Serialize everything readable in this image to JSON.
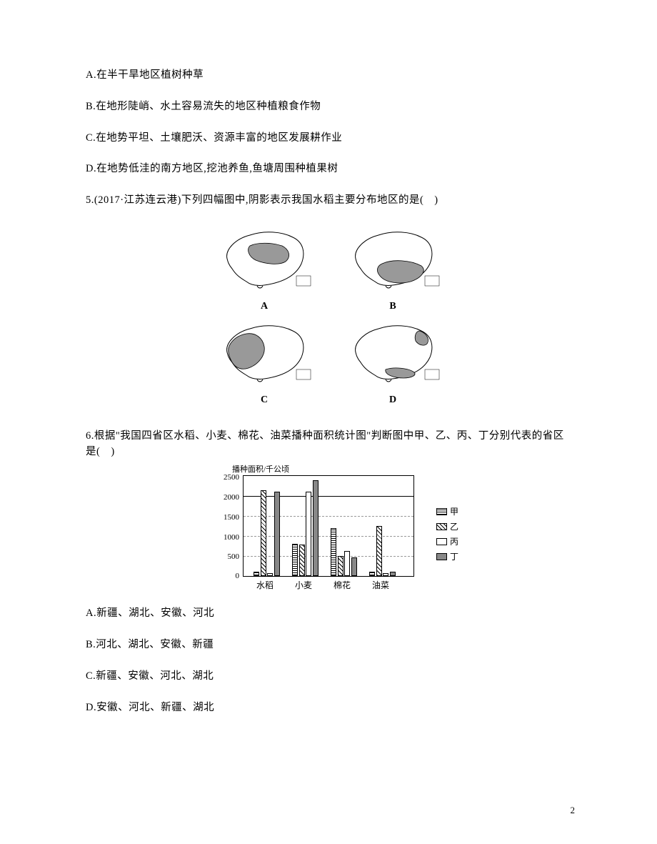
{
  "options_q4": {
    "A": "A.在半干旱地区植树种草",
    "B": "B.在地形陡峭、水土容易流失的地区种植粮食作物",
    "C": "C.在地势平坦、土壤肥沃、资源丰富的地区发展耕作业",
    "D": "D.在地势低洼的南方地区,挖池养鱼,鱼塘周围种植果树"
  },
  "q5": {
    "stem": "5.(2017·江苏连云港)下列四幅图中,阴影表示我国水稻主要分布地区的是(　)",
    "labels": {
      "A": "A",
      "B": "B",
      "C": "C",
      "D": "D"
    }
  },
  "q6": {
    "stem": "6.根据\"我国四省区水稻、小麦、棉花、油菜播种面积统计图\"判断图中甲、乙、丙、丁分别代表的省区是(　)",
    "options": {
      "A": "A.新疆、湖北、安徽、河北",
      "B": "B.河北、湖北、安徽、新疆",
      "C": "C.新疆、安徽、河北、湖北",
      "D": "D.安徽、河北、新疆、湖北"
    }
  },
  "chart_data": {
    "type": "bar",
    "title": "",
    "ylabel": "播种面积/千公顷",
    "xlabel": "",
    "ylim": [
      0,
      2500
    ],
    "yticks": [
      0,
      500,
      1000,
      1500,
      2000,
      2500
    ],
    "categories": [
      "水稻",
      "小麦",
      "棉花",
      "油菜"
    ],
    "series": [
      {
        "name": "甲",
        "values": [
          100,
          800,
          1200,
          100
        ]
      },
      {
        "name": "乙",
        "values": [
          2150,
          780,
          500,
          1250
        ]
      },
      {
        "name": "丙",
        "values": [
          60,
          2100,
          620,
          50
        ]
      },
      {
        "name": "丁",
        "values": [
          2100,
          2400,
          470,
          100
        ]
      }
    ]
  },
  "legend": {
    "jia": "甲",
    "yi": "乙",
    "bing": "丙",
    "ding": "丁"
  },
  "page_number": "2"
}
